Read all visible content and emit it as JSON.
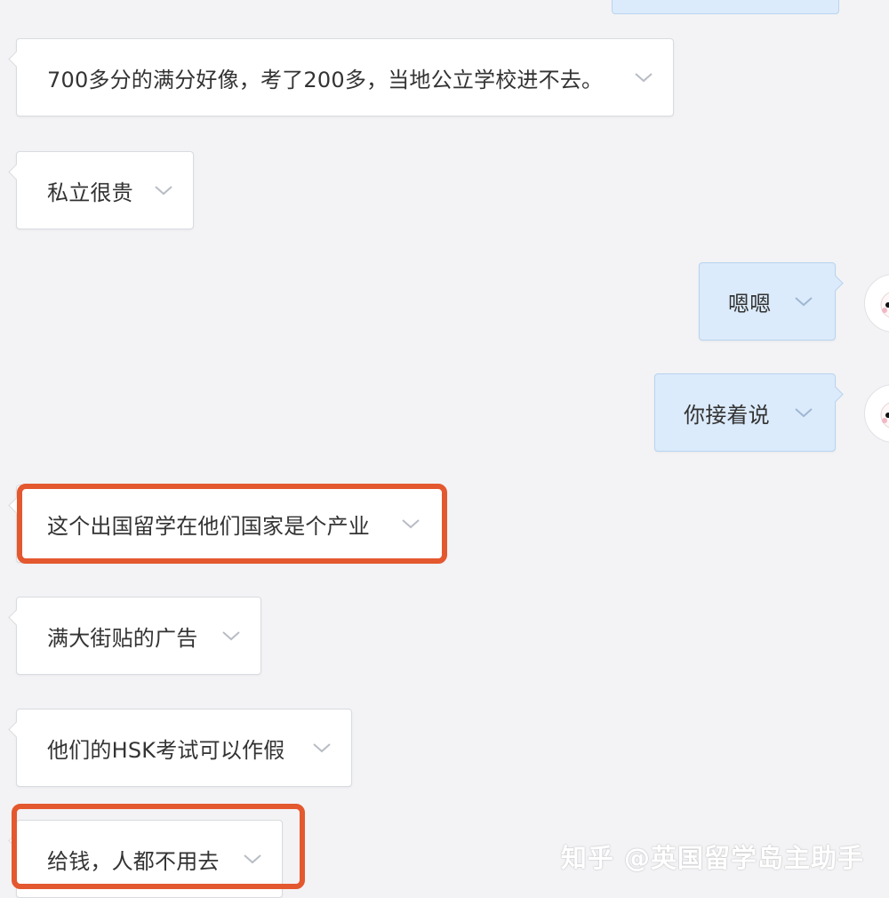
{
  "chat": {
    "messages": [
      {
        "direction": "in",
        "text": "700多分的满分好像，考了200多，当地公立学校进不去。"
      },
      {
        "direction": "in",
        "text": "私立很贵"
      },
      {
        "direction": "out",
        "text": "嗯嗯"
      },
      {
        "direction": "out",
        "text": "你接着说"
      },
      {
        "direction": "in",
        "text": "这个出国留学在他们国家是个产业"
      },
      {
        "direction": "in",
        "text": "满大街贴的广告"
      },
      {
        "direction": "in",
        "text": "他们的HSK考试可以作假"
      },
      {
        "direction": "in",
        "text": "给钱，人都不用去"
      }
    ]
  },
  "watermark": {
    "text": "知乎 @英国留学岛主助手"
  },
  "colors": {
    "background": "#f3f3f5",
    "incoming_bubble": "#ffffff",
    "outgoing_bubble": "#dcebfb",
    "highlight": "#e4582f"
  },
  "icons": {
    "expand": "chevron-down-icon",
    "avatar": "cartoon-avatar"
  }
}
